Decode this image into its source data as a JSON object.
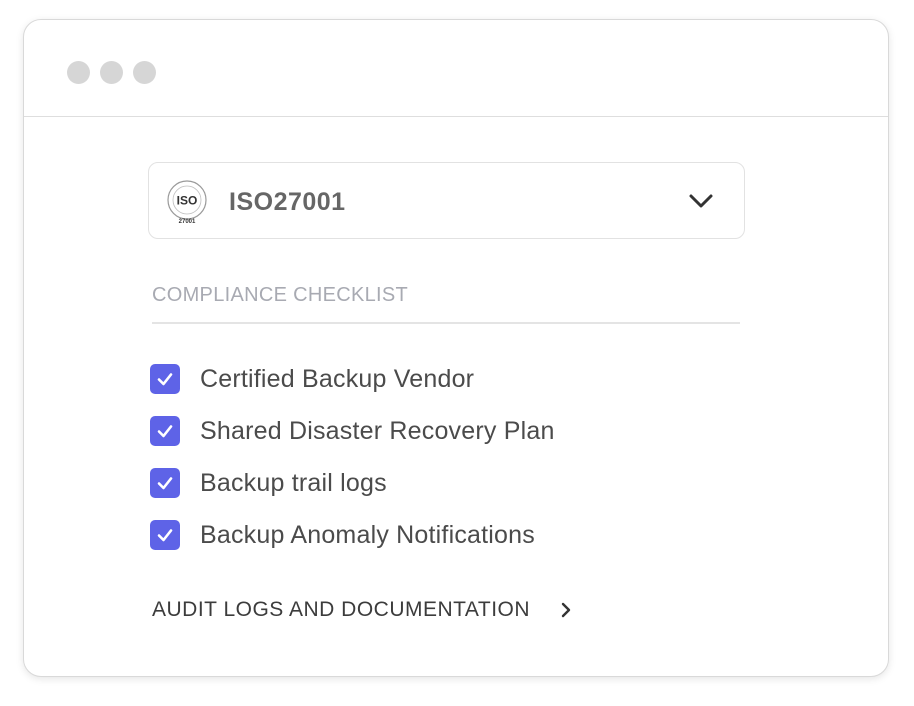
{
  "window": {
    "controls": [
      "dot",
      "dot",
      "dot"
    ]
  },
  "standard_select": {
    "selected": "ISO27001",
    "logo": {
      "icon": "iso-logo-icon",
      "text": "ISO",
      "number": "27001"
    }
  },
  "checklist": {
    "title": "COMPLIANCE CHECKLIST",
    "items": [
      {
        "label": "Certified Backup Vendor",
        "checked": true
      },
      {
        "label": "Shared Disaster Recovery Plan",
        "checked": true
      },
      {
        "label": "Backup trail logs",
        "checked": true
      },
      {
        "label": "Backup Anomaly Notifications",
        "checked": true
      }
    ]
  },
  "audit_link": {
    "label": "AUDIT LOGS AND DOCUMENTATION"
  },
  "colors": {
    "checkbox": "#5e63e7",
    "window_dot": "#d6d6d6",
    "section_title": "#a8aab2"
  }
}
